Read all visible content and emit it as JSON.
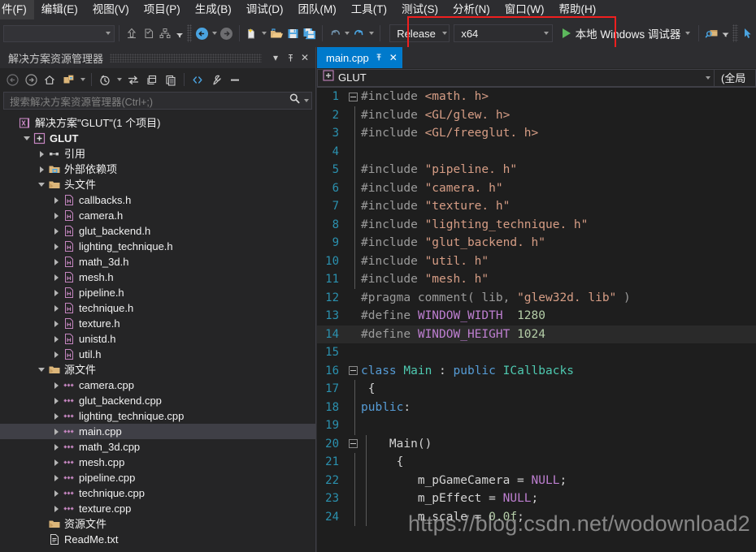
{
  "menubar": {
    "items": [
      {
        "label": "件(F)",
        "name": "menu-file"
      },
      {
        "label": "编辑(E)",
        "name": "menu-edit"
      },
      {
        "label": "视图(V)",
        "name": "menu-view"
      },
      {
        "label": "项目(P)",
        "name": "menu-project"
      },
      {
        "label": "生成(B)",
        "name": "menu-build"
      },
      {
        "label": "调试(D)",
        "name": "menu-debug"
      },
      {
        "label": "团队(M)",
        "name": "menu-team"
      },
      {
        "label": "工具(T)",
        "name": "menu-tools"
      },
      {
        "label": "测试(S)",
        "name": "menu-test"
      },
      {
        "label": "分析(N)",
        "name": "menu-analyze"
      },
      {
        "label": "窗口(W)",
        "name": "menu-window"
      },
      {
        "label": "帮助(H)",
        "name": "menu-help"
      }
    ]
  },
  "toolbar": {
    "configuration": "Release",
    "platform": "x64",
    "run_label": "本地 Windows 调试器",
    "accent_blue": "#007acc",
    "play_green": "#5cb85c",
    "annotation_red": "#f01f1f"
  },
  "solution_explorer": {
    "title": "解决方案资源管理器",
    "search_placeholder": "搜索解决方案资源管理器(Ctrl+;)",
    "tree": [
      {
        "label": "解决方案\"GLUT\"(1 个项目)",
        "indent": 0,
        "twisty": "none",
        "icon": "solution-icon",
        "bold": false,
        "selected": false
      },
      {
        "label": "GLUT",
        "indent": 1,
        "twisty": "open",
        "icon": "project-icon",
        "bold": true,
        "selected": false
      },
      {
        "label": "引用",
        "indent": 2,
        "twisty": "closed",
        "icon": "references-icon",
        "bold": false,
        "selected": false
      },
      {
        "label": "外部依赖项",
        "indent": 2,
        "twisty": "closed",
        "icon": "folder-dep-icon",
        "bold": false,
        "selected": false
      },
      {
        "label": "头文件",
        "indent": 2,
        "twisty": "open",
        "icon": "filter-folder-icon",
        "bold": false,
        "selected": false
      },
      {
        "label": "callbacks.h",
        "indent": 3,
        "twisty": "closed",
        "icon": "header-file-icon",
        "bold": false,
        "selected": false
      },
      {
        "label": "camera.h",
        "indent": 3,
        "twisty": "closed",
        "icon": "header-file-icon",
        "bold": false,
        "selected": false
      },
      {
        "label": "glut_backend.h",
        "indent": 3,
        "twisty": "closed",
        "icon": "header-file-icon",
        "bold": false,
        "selected": false
      },
      {
        "label": "lighting_technique.h",
        "indent": 3,
        "twisty": "closed",
        "icon": "header-file-icon",
        "bold": false,
        "selected": false
      },
      {
        "label": "math_3d.h",
        "indent": 3,
        "twisty": "closed",
        "icon": "header-file-icon",
        "bold": false,
        "selected": false
      },
      {
        "label": "mesh.h",
        "indent": 3,
        "twisty": "closed",
        "icon": "header-file-icon",
        "bold": false,
        "selected": false
      },
      {
        "label": "pipeline.h",
        "indent": 3,
        "twisty": "closed",
        "icon": "header-file-icon",
        "bold": false,
        "selected": false
      },
      {
        "label": "technique.h",
        "indent": 3,
        "twisty": "closed",
        "icon": "header-file-icon",
        "bold": false,
        "selected": false
      },
      {
        "label": "texture.h",
        "indent": 3,
        "twisty": "closed",
        "icon": "header-file-icon",
        "bold": false,
        "selected": false
      },
      {
        "label": "unistd.h",
        "indent": 3,
        "twisty": "closed",
        "icon": "header-file-icon",
        "bold": false,
        "selected": false
      },
      {
        "label": "util.h",
        "indent": 3,
        "twisty": "closed",
        "icon": "header-file-icon",
        "bold": false,
        "selected": false
      },
      {
        "label": "源文件",
        "indent": 2,
        "twisty": "open",
        "icon": "filter-folder-icon",
        "bold": false,
        "selected": false
      },
      {
        "label": "camera.cpp",
        "indent": 3,
        "twisty": "closed",
        "icon": "cpp-file-icon",
        "bold": false,
        "selected": false
      },
      {
        "label": "glut_backend.cpp",
        "indent": 3,
        "twisty": "closed",
        "icon": "cpp-file-icon",
        "bold": false,
        "selected": false
      },
      {
        "label": "lighting_technique.cpp",
        "indent": 3,
        "twisty": "closed",
        "icon": "cpp-file-icon",
        "bold": false,
        "selected": false
      },
      {
        "label": "main.cpp",
        "indent": 3,
        "twisty": "closed",
        "icon": "cpp-file-icon",
        "bold": false,
        "selected": true
      },
      {
        "label": "math_3d.cpp",
        "indent": 3,
        "twisty": "closed",
        "icon": "cpp-file-icon",
        "bold": false,
        "selected": false
      },
      {
        "label": "mesh.cpp",
        "indent": 3,
        "twisty": "closed",
        "icon": "cpp-file-icon",
        "bold": false,
        "selected": false
      },
      {
        "label": "pipeline.cpp",
        "indent": 3,
        "twisty": "closed",
        "icon": "cpp-file-icon",
        "bold": false,
        "selected": false
      },
      {
        "label": "technique.cpp",
        "indent": 3,
        "twisty": "closed",
        "icon": "cpp-file-icon",
        "bold": false,
        "selected": false
      },
      {
        "label": "texture.cpp",
        "indent": 3,
        "twisty": "closed",
        "icon": "cpp-file-icon",
        "bold": false,
        "selected": false
      },
      {
        "label": "资源文件",
        "indent": 2,
        "twisty": "none",
        "icon": "filter-folder-icon",
        "bold": false,
        "selected": false
      },
      {
        "label": "ReadMe.txt",
        "indent": 2,
        "twisty": "none",
        "icon": "text-file-icon",
        "bold": false,
        "selected": false
      }
    ]
  },
  "editor": {
    "tab_label": "main.cpp",
    "nav_scope": "GLUT",
    "nav_member": "(全局",
    "watermark": "https://blog.csdn.net/wodownload2",
    "lines": [
      {
        "n": "1",
        "gutter": "minus",
        "indent_line": false,
        "tokens": [
          {
            "t": "#include ",
            "c": "pp"
          },
          {
            "t": "<math. h>",
            "c": "str"
          }
        ]
      },
      {
        "n": "2",
        "gutter": "bar",
        "indent_line": false,
        "tokens": [
          {
            "t": "#include ",
            "c": "pp"
          },
          {
            "t": "<GL/glew. h>",
            "c": "str"
          }
        ]
      },
      {
        "n": "3",
        "gutter": "bar",
        "indent_line": false,
        "tokens": [
          {
            "t": "#include ",
            "c": "pp"
          },
          {
            "t": "<GL/freeglut. h>",
            "c": "str"
          }
        ]
      },
      {
        "n": "4",
        "gutter": "bar",
        "indent_line": false,
        "tokens": []
      },
      {
        "n": "5",
        "gutter": "bar",
        "indent_line": false,
        "tokens": [
          {
            "t": "#include ",
            "c": "pp"
          },
          {
            "t": "\"pipeline. h\"",
            "c": "str"
          }
        ]
      },
      {
        "n": "6",
        "gutter": "bar",
        "indent_line": false,
        "tokens": [
          {
            "t": "#include ",
            "c": "pp"
          },
          {
            "t": "\"camera. h\"",
            "c": "str"
          }
        ]
      },
      {
        "n": "7",
        "gutter": "bar",
        "indent_line": false,
        "tokens": [
          {
            "t": "#include ",
            "c": "pp"
          },
          {
            "t": "\"texture. h\"",
            "c": "str"
          }
        ]
      },
      {
        "n": "8",
        "gutter": "bar",
        "indent_line": false,
        "tokens": [
          {
            "t": "#include ",
            "c": "pp"
          },
          {
            "t": "\"lighting_technique. h\"",
            "c": "str"
          }
        ]
      },
      {
        "n": "9",
        "gutter": "bar",
        "indent_line": false,
        "tokens": [
          {
            "t": "#include ",
            "c": "pp"
          },
          {
            "t": "\"glut_backend. h\"",
            "c": "str"
          }
        ]
      },
      {
        "n": "10",
        "gutter": "bar",
        "indent_line": false,
        "tokens": [
          {
            "t": "#include ",
            "c": "pp"
          },
          {
            "t": "\"util. h\"",
            "c": "str"
          }
        ]
      },
      {
        "n": "11",
        "gutter": "bar",
        "indent_line": false,
        "tokens": [
          {
            "t": "#include ",
            "c": "pp"
          },
          {
            "t": "\"mesh. h\"",
            "c": "str"
          }
        ]
      },
      {
        "n": "12",
        "gutter": "none",
        "indent_line": false,
        "tokens": [
          {
            "t": "#pragma comment( lib, ",
            "c": "pp"
          },
          {
            "t": "\"glew32d. lib\"",
            "c": "str"
          },
          {
            "t": " )",
            "c": "pp"
          }
        ]
      },
      {
        "n": "13",
        "gutter": "none",
        "indent_line": false,
        "tokens": [
          {
            "t": "#define ",
            "c": "pp"
          },
          {
            "t": "WINDOW_WIDTH",
            "c": "mac"
          },
          {
            "t": "  ",
            "c": "plain"
          },
          {
            "t": "1280",
            "c": "num"
          }
        ]
      },
      {
        "n": "14",
        "gutter": "none",
        "highlight": true,
        "indent_line": false,
        "tokens": [
          {
            "t": "#define ",
            "c": "pp"
          },
          {
            "t": "WINDOW_HEIGHT",
            "c": "mac"
          },
          {
            "t": " ",
            "c": "plain"
          },
          {
            "t": "1024",
            "c": "num"
          }
        ]
      },
      {
        "n": "15",
        "gutter": "none",
        "indent_line": false,
        "tokens": []
      },
      {
        "n": "16",
        "gutter": "minus",
        "indent_line": false,
        "tokens": [
          {
            "t": "class ",
            "c": "kw"
          },
          {
            "t": "Main",
            "c": "type"
          },
          {
            "t": " : ",
            "c": "plain"
          },
          {
            "t": "public ",
            "c": "kw"
          },
          {
            "t": "ICallbacks",
            "c": "type"
          }
        ]
      },
      {
        "n": "17",
        "gutter": "bar",
        "indent_line": false,
        "tokens": [
          {
            "t": " {",
            "c": "plain"
          }
        ]
      },
      {
        "n": "18",
        "gutter": "bar",
        "indent_line": false,
        "tokens": [
          {
            "t": "public",
            "c": "kw"
          },
          {
            "t": ":",
            "c": "plain"
          }
        ]
      },
      {
        "n": "19",
        "gutter": "bar",
        "indent_line": false,
        "tokens": []
      },
      {
        "n": "20",
        "gutter": "minus",
        "indent_line": true,
        "tokens": [
          {
            "t": "    Main()",
            "c": "plain"
          }
        ]
      },
      {
        "n": "21",
        "gutter": "bar",
        "indent_line": true,
        "tokens": [
          {
            "t": "     {",
            "c": "plain"
          }
        ]
      },
      {
        "n": "22",
        "gutter": "bar",
        "indent_line": true,
        "tokens": [
          {
            "t": "        m_pGameCamera = ",
            "c": "plain"
          },
          {
            "t": "NULL",
            "c": "mac"
          },
          {
            "t": ";",
            "c": "plain"
          }
        ]
      },
      {
        "n": "23",
        "gutter": "bar",
        "indent_line": true,
        "tokens": [
          {
            "t": "        m_pEffect = ",
            "c": "plain"
          },
          {
            "t": "NULL",
            "c": "mac"
          },
          {
            "t": ";",
            "c": "plain"
          }
        ]
      },
      {
        "n": "24",
        "gutter": "bar",
        "indent_line": true,
        "tokens": [
          {
            "t": "        m_scale = ",
            "c": "plain"
          },
          {
            "t": "0.0f",
            "c": "num"
          },
          {
            "t": ";",
            "c": "plain"
          }
        ]
      }
    ]
  }
}
